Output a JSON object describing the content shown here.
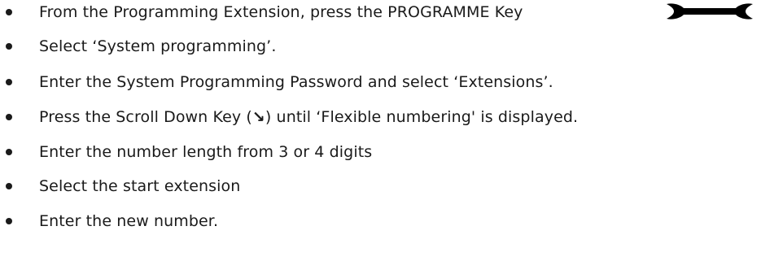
{
  "instructions": {
    "steps": [
      {
        "text": "From the Programming Extension, press the PROGRAMME Key"
      },
      {
        "text": "Select ‘System programming’."
      },
      {
        "text": "Enter the System Programming Password and select ‘Extensions’."
      },
      {
        "pre": "Press the Scroll Down Key (",
        "key": "↘",
        "post": ") until ‘Flexible numbering' is displayed."
      },
      {
        "text": "Enter the number length from 3 or 4 digits"
      },
      {
        "text": "Select the start extension"
      },
      {
        "text": "Enter the new number."
      }
    ],
    "programme_key_icon": "wrench-icon",
    "scroll_down_key_icon": "scroll-down-arrow-icon"
  }
}
